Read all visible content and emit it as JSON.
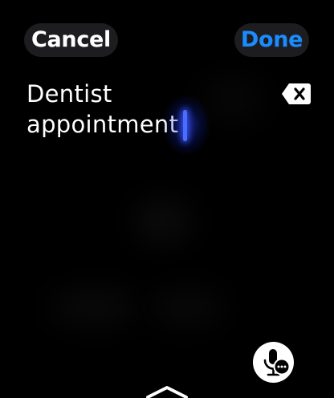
{
  "header": {
    "cancel_label": "Cancel",
    "done_label": "Done",
    "done_color": "#1a8cff"
  },
  "text_input": {
    "line1": "Dentist",
    "line2": "appointment",
    "cursor_color": "#4a6dff"
  },
  "icons": {
    "delete": "delete-backward-icon",
    "dictation": "microphone-dictation-icon",
    "scroll": "chevron-up-icon"
  }
}
